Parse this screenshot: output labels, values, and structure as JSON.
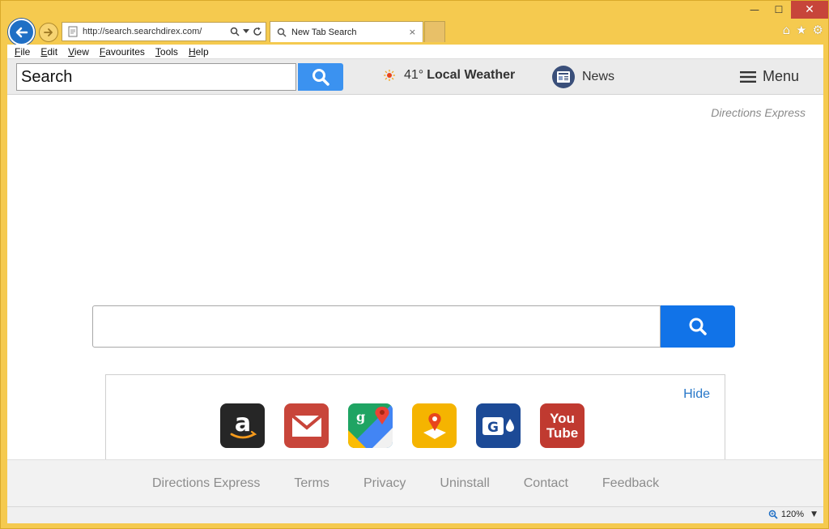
{
  "browser": {
    "address_url": "http://search.searchdirex.com/",
    "tab_title": "New Tab Search",
    "tab_close": "×",
    "window_controls": {
      "minimize": "—",
      "maximize": "☐",
      "close": "✕"
    },
    "right_icons": {
      "home": "⌂",
      "favorites": "★",
      "settings": "⚙"
    },
    "menu": [
      "File",
      "Edit",
      "View",
      "Favourites",
      "Tools",
      "Help"
    ],
    "zoom": "120%",
    "zoom_arrow": "▼"
  },
  "header": {
    "search_placeholder": "Search",
    "weather_temp": "41°",
    "weather_label": "Local Weather",
    "news_label": "News",
    "menu_label": "Menu"
  },
  "brand": "Directions Express",
  "shortcuts": {
    "hide_label": "Hide",
    "tiles": [
      {
        "name": "amazon",
        "bg": "#262626"
      },
      {
        "name": "gmail",
        "bg": "#c8453a"
      },
      {
        "name": "google-maps",
        "bg": "#ffffff"
      },
      {
        "name": "directions",
        "bg": "#f5b400"
      },
      {
        "name": "gasbuddy",
        "bg": "#1c4a96"
      },
      {
        "name": "youtube",
        "bg": "#c03a30",
        "text_top": "You",
        "text_bottom": "Tube"
      }
    ]
  },
  "footer": {
    "links": [
      "Directions Express",
      "Terms",
      "Privacy",
      "Uninstall",
      "Contact",
      "Feedback"
    ]
  },
  "colors": {
    "accent_blue": "#1173e8",
    "header_search_blue": "#3b92f0",
    "frame_yellow": "#f5ca4f"
  }
}
